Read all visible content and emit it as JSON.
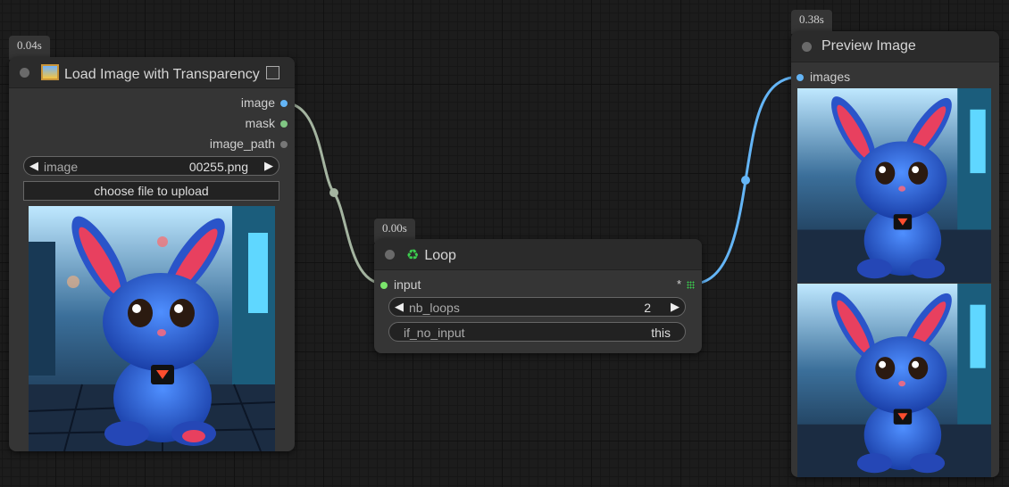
{
  "colors": {
    "image_link": "#64b5f6",
    "mask_link": "#81c784",
    "generic_link": "#a4b4a0",
    "canvas_bg": "#1c1c1c"
  },
  "load_node": {
    "time": "0.04s",
    "icon": "framed-picture-icon",
    "title": "Load Image with Transparency",
    "outputs": [
      "image",
      "mask",
      "image_path"
    ],
    "image_widget": {
      "name": "image",
      "value": "00255.png"
    },
    "upload_button": "choose file to upload",
    "preview_subject": "blue bunny plush in neon city street"
  },
  "loop_node": {
    "time": "0.00s",
    "icon": "recycle-icon",
    "title": "Loop",
    "input": "input",
    "output_marker": "*",
    "nb_loops": {
      "name": "nb_loops",
      "value": "2"
    },
    "if_no_input": {
      "name": "if_no_input",
      "value": "this"
    }
  },
  "preview_node": {
    "time": "0.38s",
    "title": "Preview Image",
    "input": "images",
    "image_count": 2
  }
}
